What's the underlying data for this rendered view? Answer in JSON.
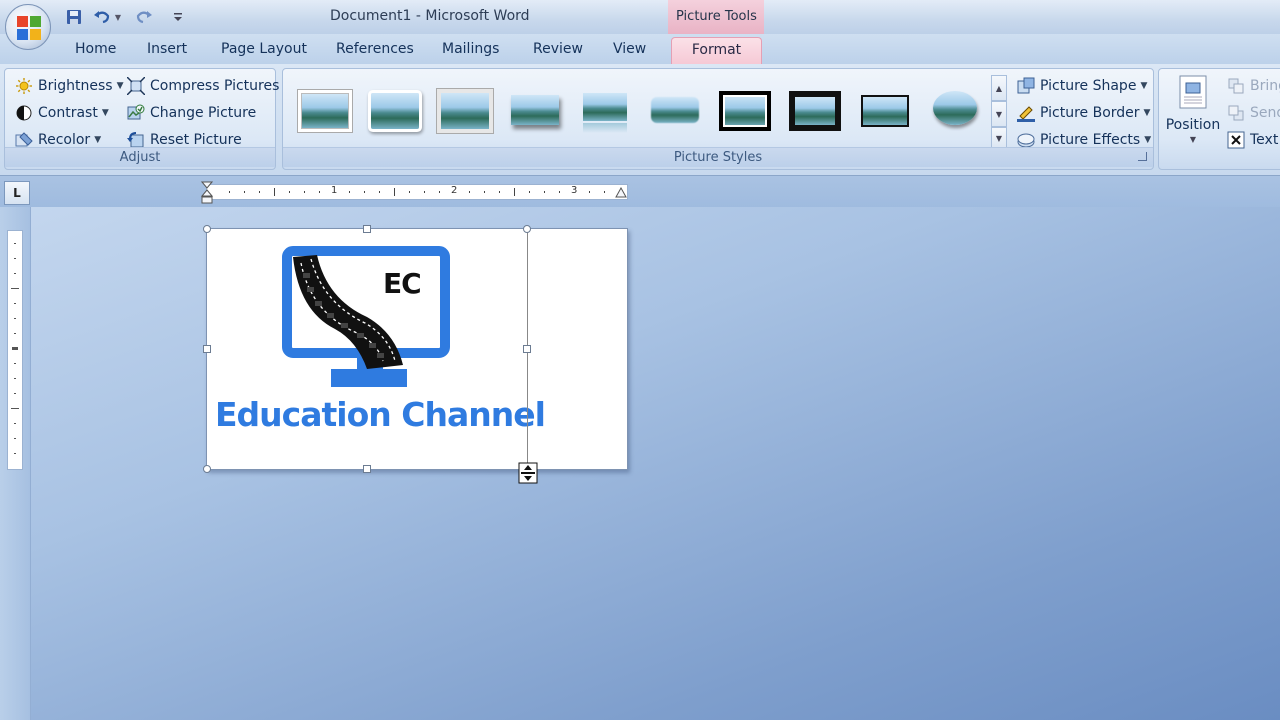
{
  "window": {
    "title": "Document1 - Microsoft Word",
    "context_tab_group": "Picture Tools"
  },
  "tabs": [
    "Home",
    "Insert",
    "Page Layout",
    "References",
    "Mailings",
    "Review",
    "View",
    "Format"
  ],
  "active_tab": "Format",
  "ribbon": {
    "adjust": {
      "label": "Adjust",
      "brightness": "Brightness",
      "contrast": "Contrast",
      "recolor": "Recolor",
      "compress": "Compress Pictures",
      "change": "Change Picture",
      "reset": "Reset Picture"
    },
    "styles": {
      "label": "Picture Styles",
      "shape": "Picture Shape",
      "border": "Picture Border",
      "effects": "Picture Effects"
    },
    "arrange": {
      "position": "Position",
      "bring": "Bring",
      "send": "Send",
      "text_wrap": "Text V"
    }
  },
  "ruler": {
    "numbers": [
      "1",
      "2",
      "3"
    ]
  },
  "picture": {
    "logo_text": "EC",
    "caption": "Education Channel"
  },
  "colors": {
    "accent_blue": "#2f7be0",
    "format_tab": "#f5c6d3"
  }
}
